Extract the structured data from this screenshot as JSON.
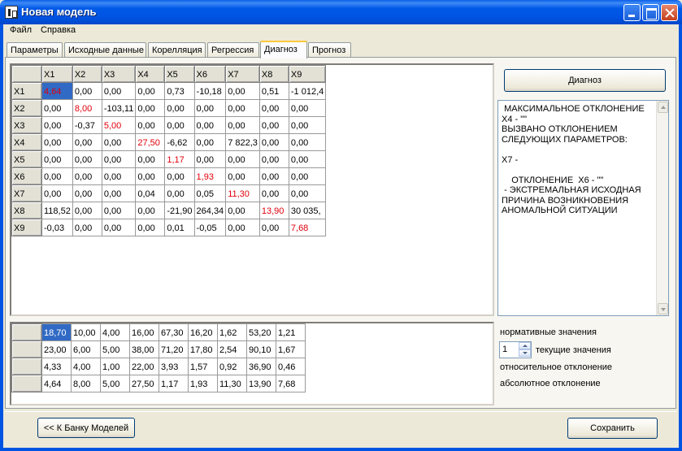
{
  "window": {
    "title": "Новая модель"
  },
  "menu": [
    "Файл",
    "Справка"
  ],
  "tabs": [
    "Параметры",
    "Исходные данные",
    "Корелляция",
    "Регрессия",
    "Диагноз",
    "Прогноз"
  ],
  "active_tab": "Диагноз",
  "diag_grid": {
    "columns": [
      "X1",
      "X2",
      "X3",
      "X4",
      "X5",
      "X6",
      "X7",
      "X8",
      "X9"
    ],
    "rows": [
      {
        "label": "X1",
        "cells": [
          "4,64",
          "0,00",
          "0,00",
          "0,00",
          "0,73",
          "-10,18",
          "0,00",
          "0,51",
          "-1 012,4"
        ]
      },
      {
        "label": "X2",
        "cells": [
          "0,00",
          "8,00",
          "-103,11",
          "0,00",
          "0,00",
          "0,00",
          "0,00",
          "0,00",
          "0,00"
        ]
      },
      {
        "label": "X3",
        "cells": [
          "0,00",
          "-0,37",
          "5,00",
          "0,00",
          "0,00",
          "0,00",
          "0,00",
          "0,00",
          "0,00"
        ]
      },
      {
        "label": "X4",
        "cells": [
          "0,00",
          "0,00",
          "0,00",
          "27,50",
          "-6,62",
          "0,00",
          "7 822,3",
          "0,00",
          "0,00"
        ]
      },
      {
        "label": "X5",
        "cells": [
          "0,00",
          "0,00",
          "0,00",
          "0,00",
          "1,17",
          "0,00",
          "0,00",
          "0,00",
          "0,00"
        ]
      },
      {
        "label": "X6",
        "cells": [
          "0,00",
          "0,00",
          "0,00",
          "0,00",
          "0,00",
          "1,93",
          "0,00",
          "0,00",
          "0,00"
        ]
      },
      {
        "label": "X7",
        "cells": [
          "0,00",
          "0,00",
          "0,00",
          "0,04",
          "0,00",
          "0,05",
          "11,30",
          "0,00",
          "0,00"
        ]
      },
      {
        "label": "X8",
        "cells": [
          "118,52",
          "0,00",
          "0,00",
          "0,00",
          "-21,90",
          "264,34",
          "0,00",
          "13,90",
          "30 035,"
        ]
      },
      {
        "label": "X9",
        "cells": [
          "-0,03",
          "0,00",
          "0,00",
          "0,00",
          "0,01",
          "-0,05",
          "0,00",
          "0,00",
          "7,68"
        ]
      }
    ]
  },
  "values_grid": {
    "rows": [
      [
        "18,70",
        "10,00",
        "4,00",
        "16,00",
        "67,30",
        "16,20",
        "1,62",
        "53,20",
        "1,21"
      ],
      [
        "23,00",
        "6,00",
        "5,00",
        "38,00",
        "71,20",
        "17,80",
        "2,54",
        "90,10",
        "1,67"
      ],
      [
        "4,33",
        "4,00",
        "1,00",
        "22,00",
        "3,93",
        "1,57",
        "0,92",
        "36,90",
        "0,46"
      ],
      [
        "4,64",
        "8,00",
        "5,00",
        "27,50",
        "1,17",
        "1,93",
        "11,30",
        "13,90",
        "7,68"
      ]
    ]
  },
  "buttons": {
    "diagnose": "Диагноз",
    "back": "<< К Банку Моделей",
    "save": "Сохранить"
  },
  "memo_text": " Максимальное отклонение\nX4 - \"\"\nвызвано отклонением\nследующих параметров:\n\nX7 -\n\n    Отклонение  X6 - \"\"\n - экстремальная исходная\nпричина возникновения\nаномальной ситуации",
  "legend": {
    "normative": "нормативные значения",
    "current": "текущие значения",
    "relative": "относительное отклонение",
    "absolute": "абсолютное отклонение"
  },
  "spin_value": "1",
  "colors": {
    "highlight_text": "#e0000b",
    "selection": "#316ac5"
  }
}
